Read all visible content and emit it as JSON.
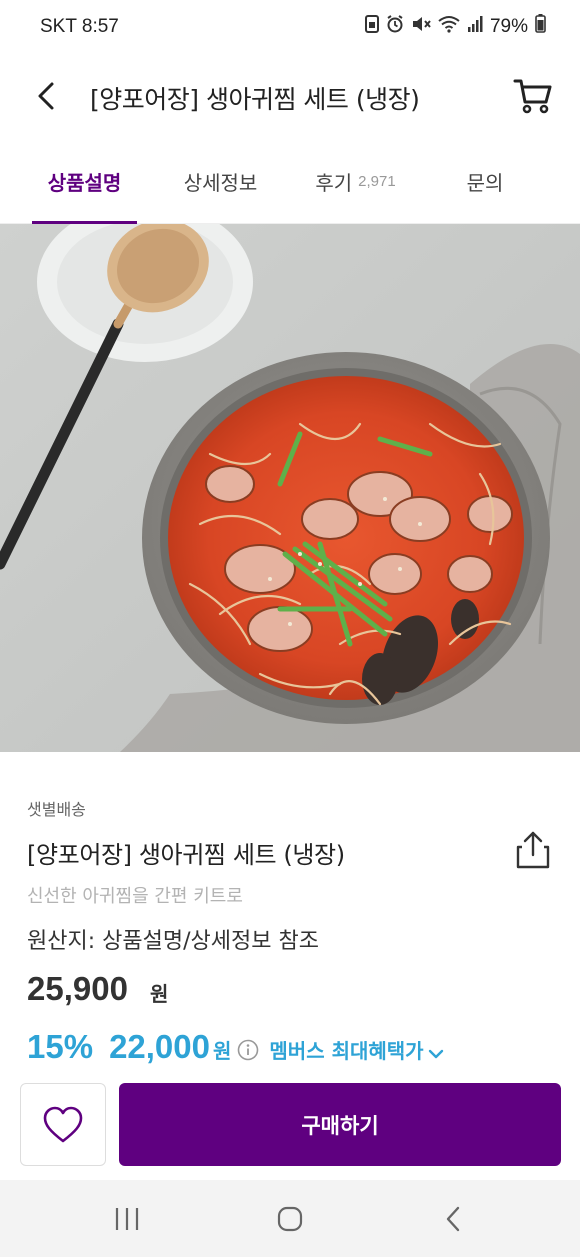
{
  "status_bar": {
    "carrier_time": "SKT 8:57",
    "battery": "79%"
  },
  "header": {
    "title": "[양포어장] 생아귀찜 세트 (냉장)"
  },
  "tabs": [
    {
      "label": "상품설명",
      "active": true
    },
    {
      "label": "상세정보",
      "active": false
    },
    {
      "label": "후기",
      "count": "2,971",
      "active": false
    },
    {
      "label": "문의",
      "active": false
    }
  ],
  "product": {
    "delivery_type": "샛별배송",
    "name": "[양포어장] 생아귀찜 세트 (냉장)",
    "subtitle": "신선한 아귀찜을 간편 키트로",
    "origin": "원산지: 상품설명/상세정보 참조",
    "original_price": "25,900",
    "price_unit": "원",
    "discount_rate": "15%",
    "sale_price": "22,000",
    "sale_unit": "원",
    "member_benefit": "멤버스 최대혜택가"
  },
  "actions": {
    "buy_label": "구매하기"
  },
  "colors": {
    "brand_purple": "#5f0080",
    "discount_blue": "#2ea3d6"
  }
}
